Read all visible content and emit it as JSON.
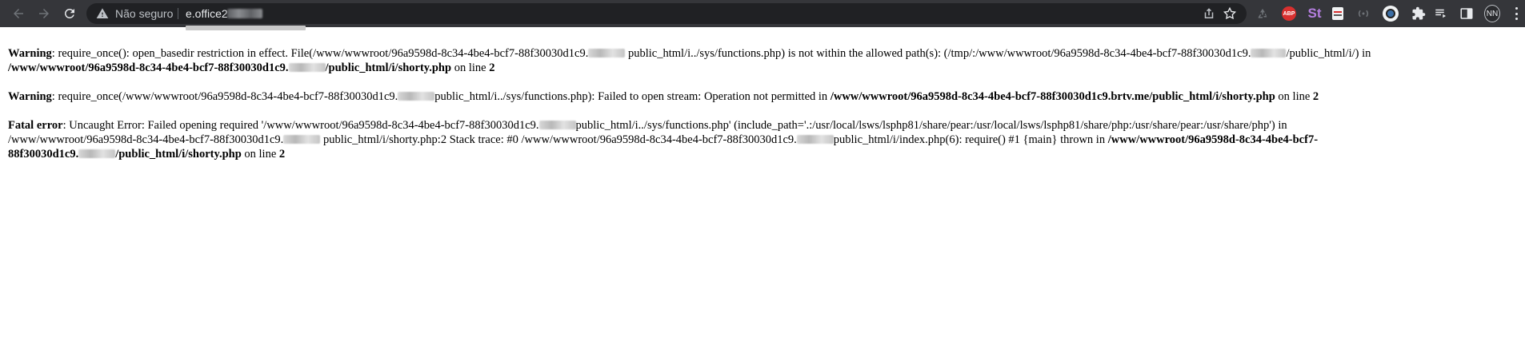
{
  "browser": {
    "security_label": "Não seguro",
    "url_text": "e.office2",
    "profile_initials": "NN",
    "colors": {
      "toolbar": "#35363a",
      "omnibox": "#202124",
      "abp": "#d8302f"
    },
    "extensions": [
      "recycle-icon",
      "adblock-plus-icon",
      "st-icon",
      "notes-icon",
      "radio-icon",
      "avatar-extension-icon",
      "puzzle-icon",
      "queue-icon",
      "side-panel-icon"
    ],
    "abp_label": "ABP",
    "st_label": "St"
  },
  "errors": {
    "warning1": {
      "label": "Warning",
      "text_a": ": require_once(): open_basedir restriction in effect. File(/www/wwwroot/96a9598d-8c34-4be4-bcf7-88f30030d1c9.",
      "text_b": "public_html/i../sys/functions.php) is not within the allowed path(s): (/tmp/:/www/wwwroot/96a9598d-8c34-4be4-bcf7-88f30030d1c9.",
      "text_c": "/public_html/i/) in",
      "path_a": "/www/wwwroot/96a9598d-8c34-4be4-bcf7-88f30030d1c9.",
      "path_b": "/public_html/i/shorty.php",
      "line_text": " on line ",
      "line_no": "2"
    },
    "warning2": {
      "label": "Warning",
      "text_a": ": require_once(/www/wwwroot/96a9598d-8c34-4be4-bcf7-88f30030d1c9.",
      "text_b": "public_html/i../sys/functions.php): Failed to open stream: Operation not permitted in ",
      "path": "/www/wwwroot/96a9598d-8c34-4be4-bcf7-88f30030d1c9.brtv.me/public_html/i/shorty.php",
      "line_text": " on line ",
      "line_no": "2"
    },
    "fatal": {
      "label": "Fatal error",
      "text_a": ": Uncaught Error: Failed opening required '/www/wwwroot/96a9598d-8c34-4be4-bcf7-88f30030d1c9.",
      "text_b": "public_html/i../sys/functions.php' (include_path='.:/usr/local/lsws/lsphp81/share/pear:/usr/local/lsws/lsphp81/share/php:/usr/share/pear:/usr/share/php') in",
      "text_c": "/www/wwwroot/96a9598d-8c34-4be4-bcf7-88f30030d1c9.",
      "text_d": "public_html/i/shorty.php:2 Stack trace: #0 /www/wwwroot/96a9598d-8c34-4be4-bcf7-88f30030d1c9.",
      "text_e": "public_html/i/index.php(6): require() #1 {main} thrown in ",
      "path_a": "/www/wwwroot/96a9598d-8c34-4be4-bcf7-",
      "path_b": "88f30030d1c9.",
      "path_c": "/public_html/i/shorty.php",
      "line_text": " on line ",
      "line_no": "2"
    }
  }
}
